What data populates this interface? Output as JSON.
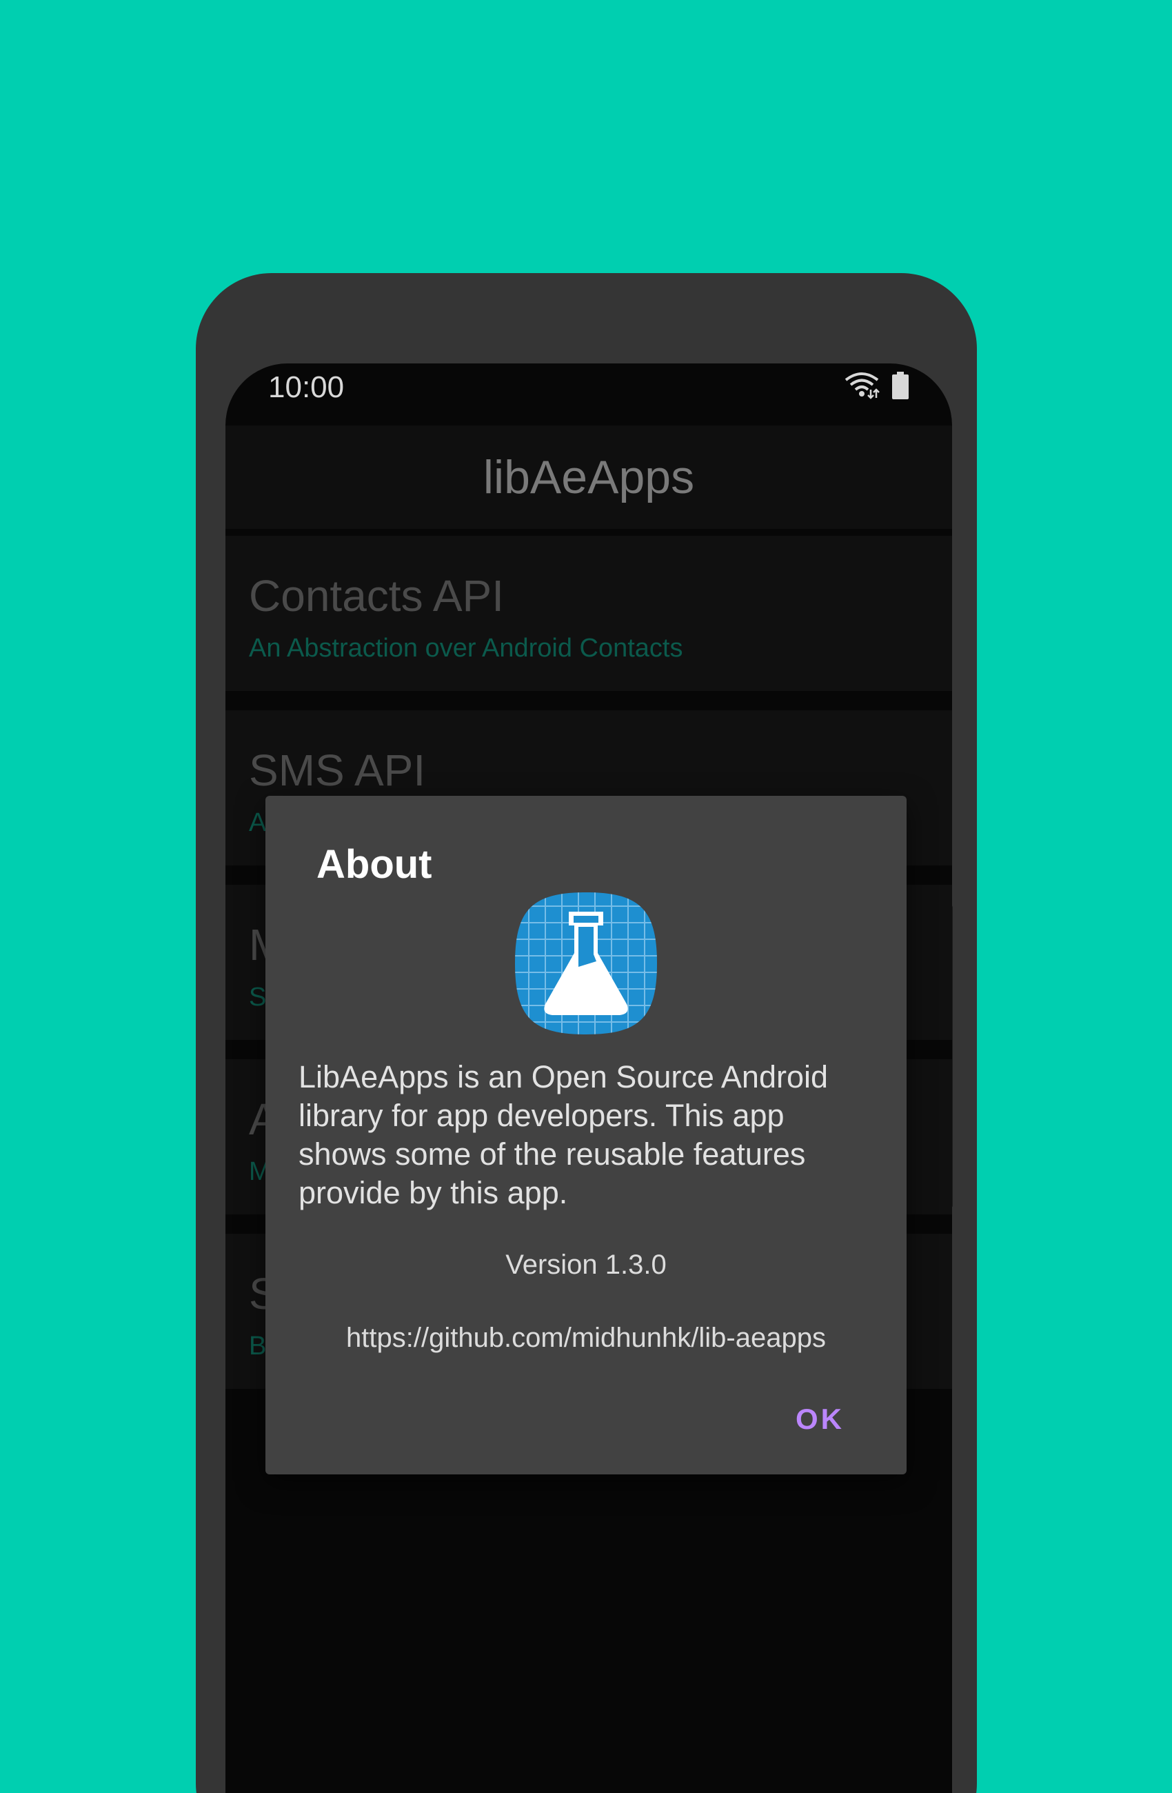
{
  "status_bar": {
    "time": "10:00",
    "icons": [
      "wifi-icon",
      "battery-icon"
    ]
  },
  "app_bar": {
    "title": "libAeApps"
  },
  "list": {
    "items": [
      {
        "title": "Contacts API",
        "subtitle": "An Abstraction over Android Contacts"
      },
      {
        "title": "SMS API",
        "subtitle": "A"
      },
      {
        "title": "M",
        "subtitle": "S"
      },
      {
        "title": "A",
        "subtitle": "M"
      },
      {
        "title": "S",
        "subtitle": "B"
      }
    ]
  },
  "dialog": {
    "title": "About",
    "icon": "flask-icon",
    "body": "LibAeApps is an Open Source Android library for app developers. This app shows some of the reusable features provide by this app.",
    "version": "Version 1.3.0",
    "link": "https://github.com/midhunhk/lib-aeapps",
    "ok_label": "OK"
  },
  "colors": {
    "background": "#00cfb0",
    "accent": "#bb86fc",
    "icon_blue": "#1e8fd0",
    "subtitle_teal": "#0b5a4c"
  }
}
